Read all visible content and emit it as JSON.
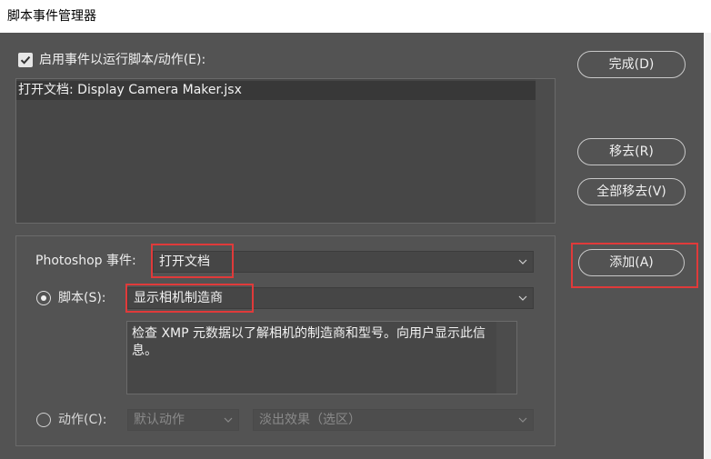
{
  "window": {
    "title": "脚本事件管理器"
  },
  "enable": {
    "label": "启用事件以运行脚本/动作(E):",
    "checked": true
  },
  "event_list": {
    "items": [
      "打开文档: Display Camera Maker.jsx"
    ]
  },
  "buttons": {
    "done": "完成(D)",
    "remove": "移去(R)",
    "remove_all": "全部移去(V)",
    "add": "添加(A)"
  },
  "form": {
    "ps_event_label": "Photoshop 事件:",
    "ps_event_value": "打开文档",
    "script_label": "脚本(S):",
    "script_value": "显示相机制造商",
    "description": "检查 XMP 元数据以了解相机的制造商和型号。向用户显示此信息。",
    "action_label": "动作(C):",
    "action_set_value": "默认动作",
    "action_value": "淡出效果（选区）"
  },
  "colors": {
    "background": "#535353",
    "highlight": "#e03a3a",
    "title_bar": "#ffffff"
  }
}
